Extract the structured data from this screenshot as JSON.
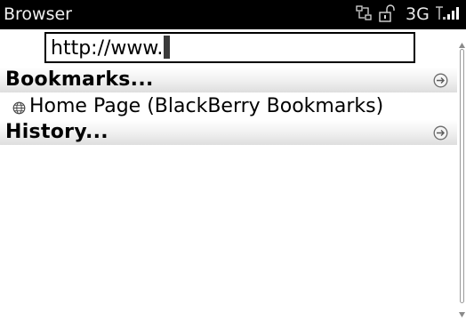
{
  "status_bar": {
    "app_title": "Browser",
    "network": "3G",
    "icons": [
      "data-transfer-icon",
      "unlock-icon",
      "signal-strength-icon"
    ]
  },
  "address_bar": {
    "value": "http://www."
  },
  "sections": {
    "bookmarks_label": "Bookmarks...",
    "history_label": "History..."
  },
  "bookmarks": [
    {
      "label": "Home Page (BlackBerry Bookmarks)",
      "icon": "globe-icon"
    }
  ],
  "colors": {
    "status_bar_bg": "#000000",
    "section_row_bg": "#e6e6e6",
    "text": "#000000"
  }
}
